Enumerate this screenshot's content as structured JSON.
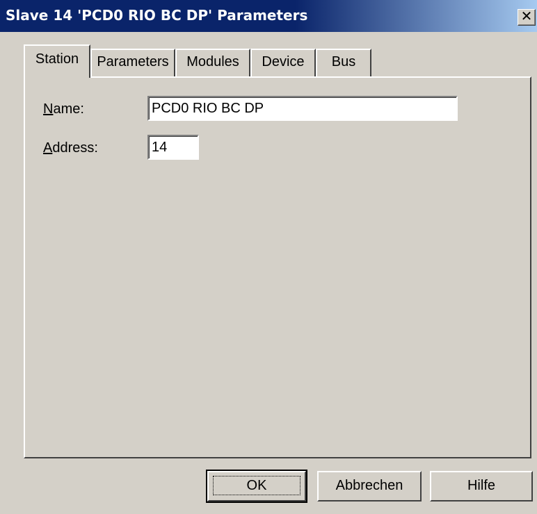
{
  "window": {
    "title": "Slave 14 'PCD0 RIO BC DP' Parameters",
    "close_glyph": "✕"
  },
  "tabs": [
    {
      "label": "Station"
    },
    {
      "label": "Parameters"
    },
    {
      "label": "Modules"
    },
    {
      "label": "Device"
    },
    {
      "label": "Bus"
    }
  ],
  "form": {
    "name_label_accel": "N",
    "name_label_rest": "ame:",
    "name_value": "PCD0 RIO BC DP",
    "address_label_accel": "A",
    "address_label_rest": "ddress:",
    "address_value": "14"
  },
  "buttons": {
    "ok": "OK",
    "cancel": "Abbrechen",
    "help": "Hilfe"
  }
}
